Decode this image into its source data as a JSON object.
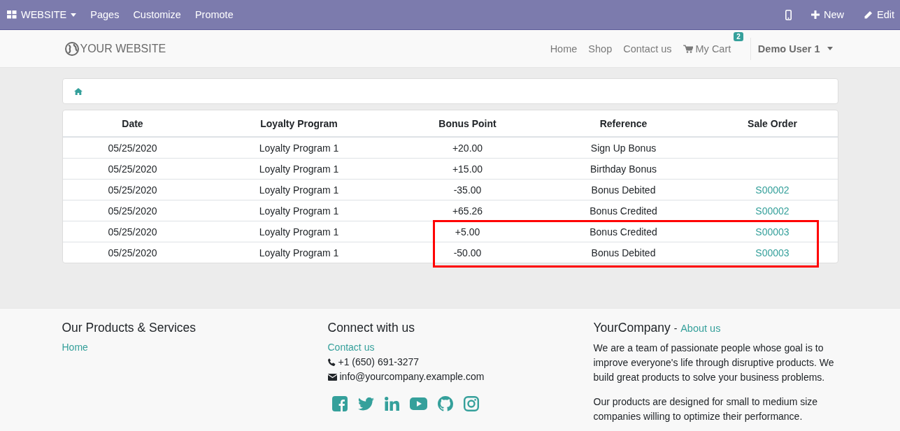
{
  "admin_bar": {
    "app_menu": "WEBSITE",
    "menus": [
      "Pages",
      "Customize",
      "Promote"
    ],
    "actions": [
      {
        "kind": "mobile"
      },
      {
        "kind": "new",
        "label": "New"
      },
      {
        "kind": "edit",
        "label": "Edit"
      }
    ]
  },
  "header": {
    "logo": "YOUR WEBSITE",
    "nav": [
      {
        "label": "Home"
      },
      {
        "label": "Shop"
      },
      {
        "label": "Contact us"
      }
    ],
    "cart": {
      "label": "My Cart",
      "count": "2"
    },
    "user": "Demo User 1"
  },
  "table": {
    "columns": [
      "Date",
      "Loyalty Program",
      "Bonus Point",
      "Reference",
      "Sale Order"
    ],
    "rows": [
      [
        "05/25/2020",
        "Loyalty Program 1",
        "+20.00",
        "Sign Up Bonus",
        ""
      ],
      [
        "05/25/2020",
        "Loyalty Program 1",
        "+15.00",
        "Birthday Bonus",
        ""
      ],
      [
        "05/25/2020",
        "Loyalty Program 1",
        "-35.00",
        "Bonus Debited",
        "S00002"
      ],
      [
        "05/25/2020",
        "Loyalty Program 1",
        "+65.26",
        "Bonus Credited",
        "S00002"
      ],
      [
        "05/25/2020",
        "Loyalty Program 1",
        "+5.00",
        "Bonus Credited",
        "S00003"
      ],
      [
        "05/25/2020",
        "Loyalty Program 1",
        "-50.00",
        "Bonus Debited",
        "S00003"
      ]
    ]
  },
  "footer": {
    "products": {
      "title": "Our Products & Services",
      "links": [
        "Home"
      ]
    },
    "connect": {
      "title": "Connect with us",
      "link": "Contact us",
      "phone": "+1 (650) 691-3277",
      "email": "info@yourcompany.example.com",
      "social": [
        {
          "kind": "facebook"
        },
        {
          "kind": "twitter"
        },
        {
          "kind": "linkedin"
        },
        {
          "kind": "youtube"
        },
        {
          "kind": "github"
        },
        {
          "kind": "instagram"
        }
      ]
    },
    "company": {
      "title": "YourCompany",
      "separator": "-",
      "link": "About us",
      "paragraphs": [
        "We are a team of passionate people whose goal is to improve everyone's life through disruptive products. We build great products to solve your business problems.",
        "Our products are designed for small to medium size companies willing to optimize their performance."
      ]
    }
  }
}
